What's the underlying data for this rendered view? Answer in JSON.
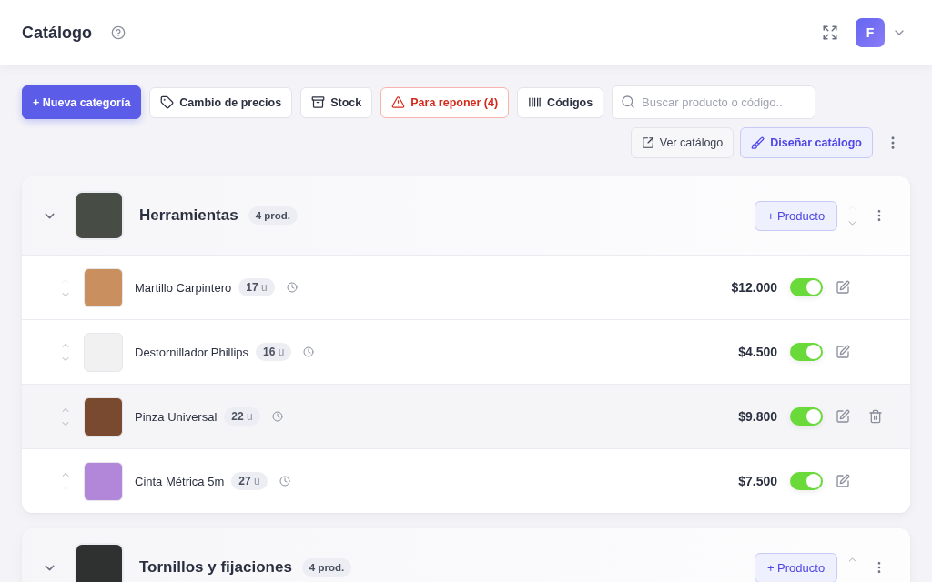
{
  "header": {
    "title": "Catálogo",
    "user_initial": "F"
  },
  "toolbar": {
    "new_category": "+ Nueva categoría",
    "price_change": "Cambio de precios",
    "stock": "Stock",
    "restock": "Para reponer (4)",
    "codes": "Códigos",
    "search": {
      "placeholder": "Buscar producto o código.."
    },
    "view_catalog": "Ver catálogo",
    "design_catalog": "Diseñar catálogo"
  },
  "categories": [
    {
      "name": "Herramientas",
      "count": "4 prod.",
      "expanded": true,
      "move_up": false,
      "move_down": true,
      "add_product": "+ Producto",
      "products": [
        {
          "name": "Martillo Carpintero",
          "stock": "17",
          "unit": "u",
          "price": "$12.000",
          "active": true,
          "hovered": false,
          "move_up": false,
          "move_down": true
        },
        {
          "name": "Destornillador Phillips",
          "stock": "16",
          "unit": "u",
          "price": "$4.500",
          "active": true,
          "hovered": false,
          "move_up": true,
          "move_down": true
        },
        {
          "name": "Pinza Universal",
          "stock": "22",
          "unit": "u",
          "price": "$9.800",
          "active": true,
          "hovered": true,
          "move_up": true,
          "move_down": true
        },
        {
          "name": "Cinta Métrica 5m",
          "stock": "27",
          "unit": "u",
          "price": "$7.500",
          "active": true,
          "hovered": false,
          "move_up": true,
          "move_down": false
        }
      ]
    },
    {
      "name": "Tornillos y fijaciones",
      "count": "4 prod.",
      "expanded": true,
      "move_up": true,
      "add_product": "+ Producto"
    }
  ]
}
